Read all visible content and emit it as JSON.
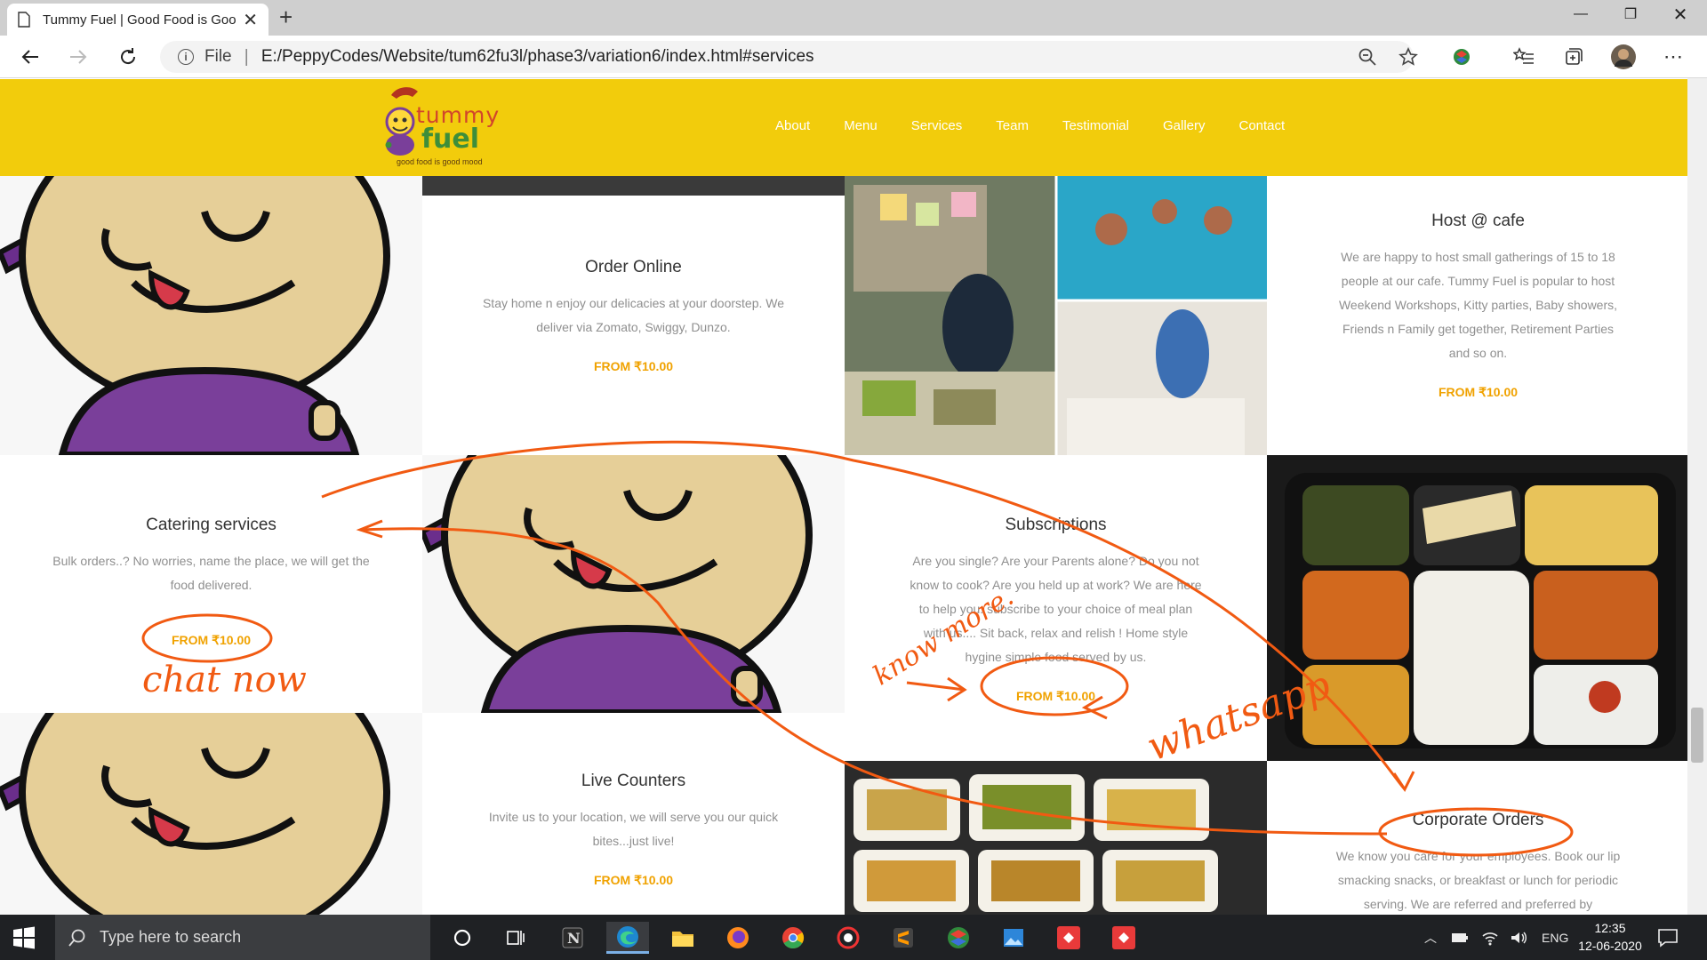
{
  "browser": {
    "tab_title": "Tummy Fuel | Good Food is Good Mood",
    "address_scheme": "File",
    "address_url": "E:/PeppyCodes/Website/tum62fu3l/phase3/variation6/index.html#services"
  },
  "site": {
    "logo_top": "tummy",
    "logo_mid": "fuel",
    "logo_tagline": "good food is good mood",
    "menu": [
      "About",
      "Menu",
      "Services",
      "Team",
      "Testimonial",
      "Gallery",
      "Contact"
    ]
  },
  "services": {
    "order_online": {
      "title": "Order Online",
      "desc": "Stay home n enjoy our delicacies at your doorstep. We deliver via Zomato, Swiggy, Dunzo.",
      "price": "FROM ₹10.00"
    },
    "host_cafe": {
      "title": "Host @ cafe",
      "desc": "We are happy to host small gatherings of 15 to 18 people at our cafe. Tummy Fuel is popular to host Weekend Workshops, Kitty parties, Baby showers, Friends n Family get together, Retirement Parties and so on.",
      "price": "FROM ₹10.00"
    },
    "catering": {
      "title": "Catering services",
      "desc": "Bulk orders..? No worries, name the place, we will get the food delivered.",
      "price": "FROM ₹10.00"
    },
    "subscriptions": {
      "title": "Subscriptions",
      "desc": "Are you single? Are your Parents alone? Do you not know to cook? Are you held up at work? We are here to help you. subscribe to your choice of meal plan with us.... Sit back, relax and relish ! Home style hygine simple food served by us.",
      "price": "FROM ₹10.00"
    },
    "live_counters": {
      "title": "Live Counters",
      "desc": "Invite us to your location, we will serve you our quick bites...just live!",
      "price": "FROM ₹10.00"
    },
    "corporate": {
      "title": "Corporate Orders",
      "desc": "We know you care for your employees. Book our lip smacking snacks, or breakfast or lunch for periodic serving. We are referred and preferred by"
    }
  },
  "annotations": {
    "chat_now": "chat now",
    "know_more": "know more.",
    "whatsapp": "whatsapp"
  },
  "taskbar": {
    "search_placeholder": "Type here to search",
    "lang": "ENG",
    "time": "12:35",
    "date": "12-06-2020"
  },
  "colors": {
    "header_yellow": "#f2cc0c",
    "price_orange": "#f0a200",
    "annotation_orange": "#f15a12",
    "mascot_purple": "#7a3f9a"
  }
}
